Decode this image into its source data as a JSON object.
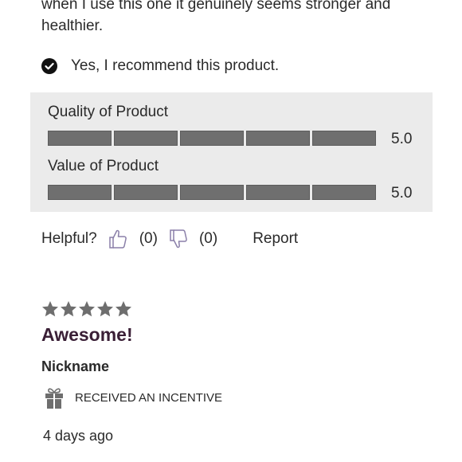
{
  "review": {
    "text": "when I use this one it genuinely seems stronger and healthier.",
    "recommend_text": "Yes, I recommend this product."
  },
  "ratings": [
    {
      "label": "Quality of Product",
      "value": "5.0",
      "score": 5,
      "max": 5
    },
    {
      "label": "Value of Product",
      "value": "5.0",
      "score": 5,
      "max": 5
    }
  ],
  "helpful": {
    "label": "Helpful?",
    "up_count": "(0)",
    "down_count": "(0)",
    "report_label": "Report"
  },
  "next_review": {
    "stars": 5,
    "title": "Awesome!",
    "nickname": "Nickname",
    "incentive_text": "RECEIVED AN INCENTIVE",
    "date": "4 days ago"
  },
  "colors": {
    "bar": "#6f6f6f",
    "panel": "#ebebeb",
    "star": "#6e6e6e",
    "title": "#3a1f36",
    "thumb": "#8a7fa8"
  }
}
